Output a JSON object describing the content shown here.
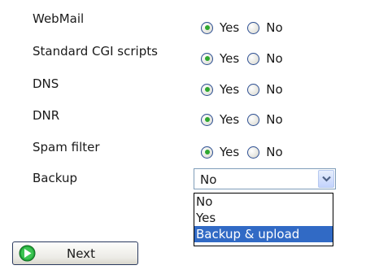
{
  "options": [
    {
      "label": "WebMail",
      "yes_label": "Yes",
      "no_label": "No",
      "selected": "Yes"
    },
    {
      "label": "Standard CGI scripts",
      "yes_label": "Yes",
      "no_label": "No",
      "selected": "Yes"
    },
    {
      "label": "DNS",
      "yes_label": "Yes",
      "no_label": "No",
      "selected": "Yes"
    },
    {
      "label": "DNR",
      "yes_label": "Yes",
      "no_label": "No",
      "selected": "Yes"
    },
    {
      "label": "Spam filter",
      "yes_label": "Yes",
      "no_label": "No",
      "selected": "Yes"
    }
  ],
  "backup": {
    "label": "Backup",
    "value": "No",
    "dropdown_items": [
      "No",
      "Yes",
      "Backup & upload"
    ],
    "highlighted_item": "Backup & upload"
  },
  "next_button": {
    "label": "Next",
    "icon": "green-arrow-right-icon"
  },
  "colors": {
    "radio_dot": "#2fa830",
    "highlight": "#316ac5",
    "border": "#7f9db9"
  }
}
